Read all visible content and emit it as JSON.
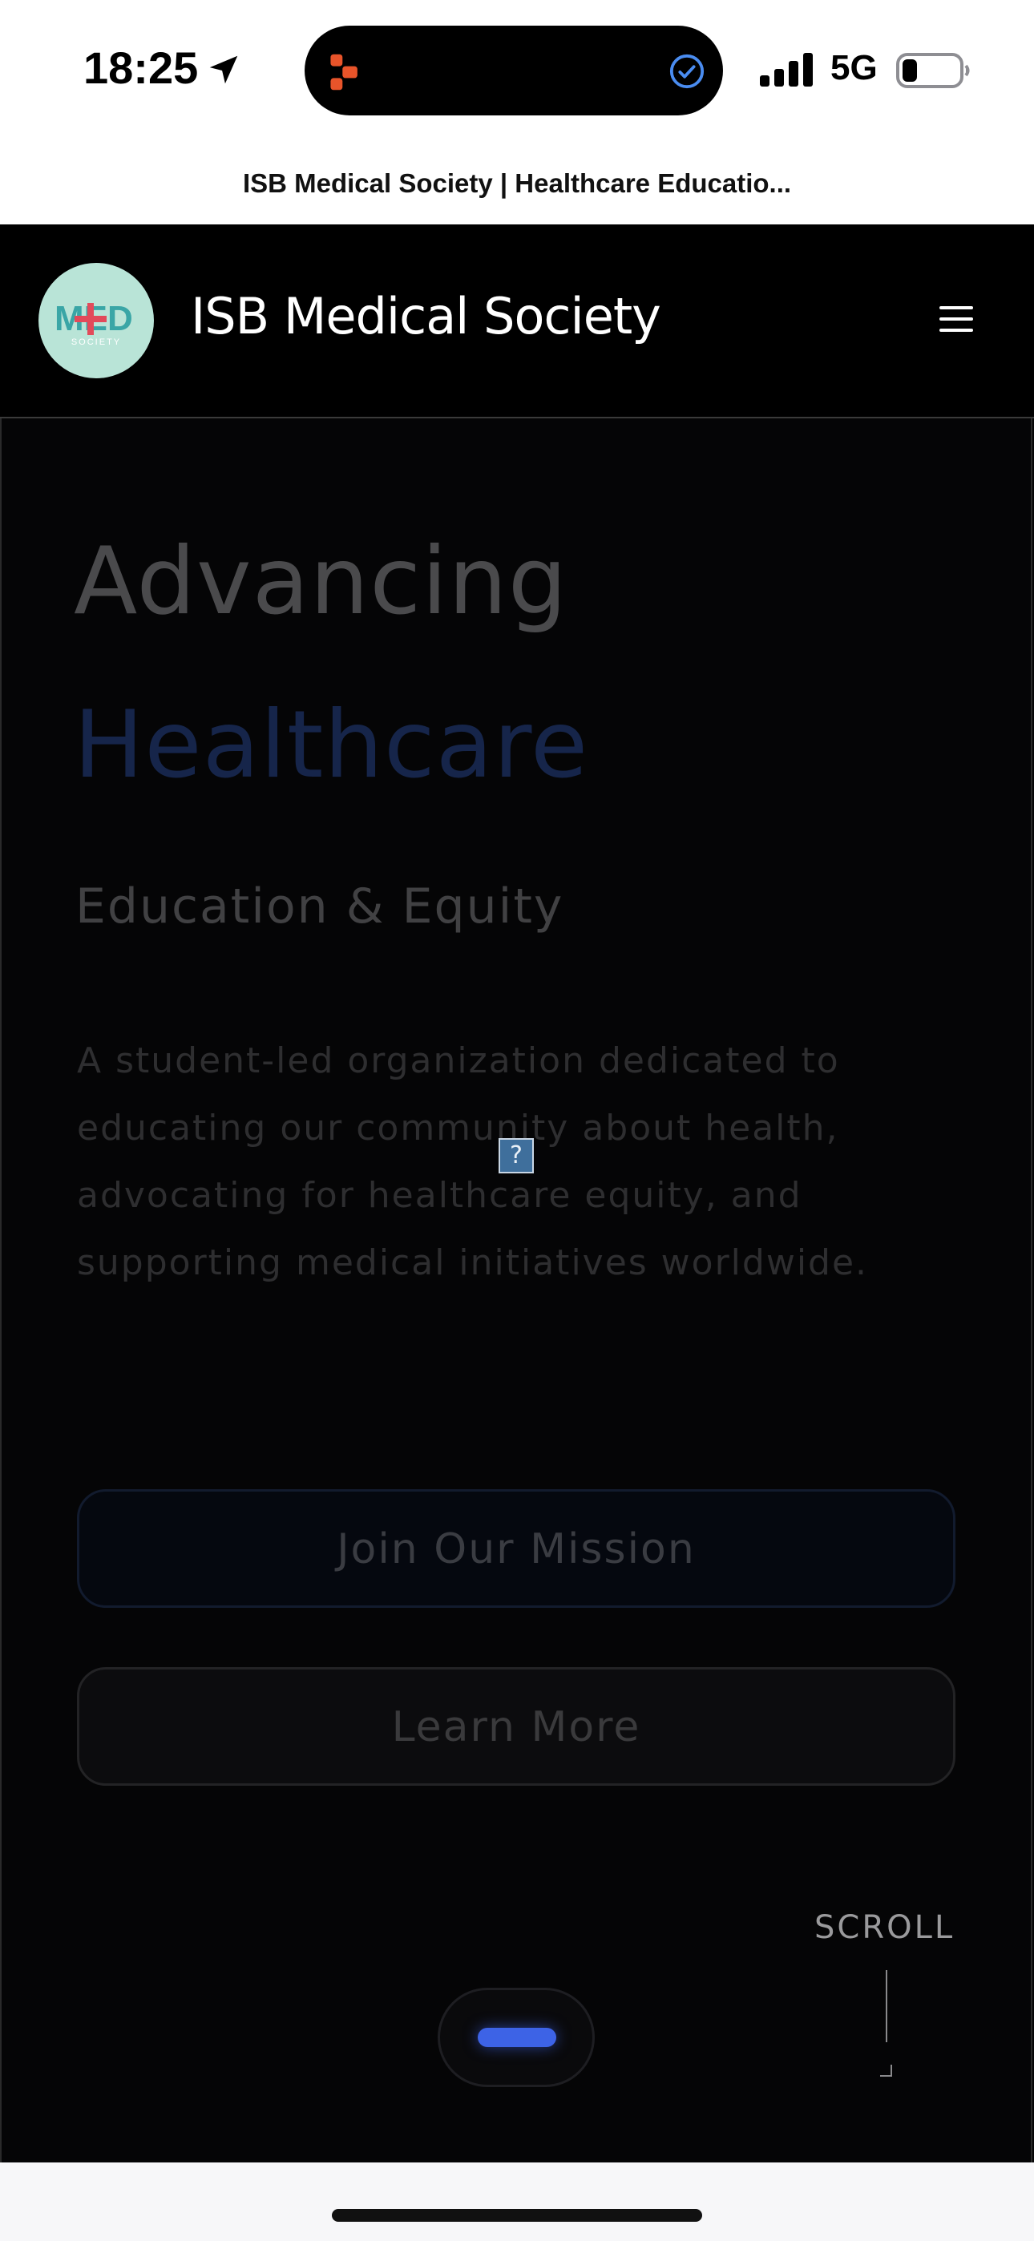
{
  "status_bar": {
    "time": "18:25",
    "network": "5G",
    "icons": [
      "location-arrow-icon",
      "app-activity-icon",
      "checkmark-circle-icon",
      "cellular-signal-icon",
      "battery-icon"
    ],
    "colors": {
      "app_icon": "#e8542a",
      "check_icon": "#4a8cf0"
    }
  },
  "browser": {
    "page_title": "ISB Medical Society | Healthcare Educatio..."
  },
  "header": {
    "site_name": "ISB Medical Society",
    "logo": {
      "text": "MED",
      "subtext": "SOCIETY",
      "background": "#b9e4d7",
      "accent": "#e24a5a",
      "text_color": "#3aa6a6"
    },
    "menu_icon": "hamburger-menu-icon"
  },
  "hero": {
    "headline_line1": "Advancing",
    "headline_line2": "Healthcare",
    "subheadline": "Education & Equity",
    "description": "A student-led organization dedicated to educating our community about health, advocating for healthcare equity, and supporting medical initiatives worldwide.",
    "broken_image_glyph": "?",
    "primary_button": "Join Our Mission",
    "secondary_button": "Learn More",
    "scroll_label": "SCROLL",
    "colors": {
      "accent": "#3d63e6",
      "headline_blue": "#16254a"
    }
  }
}
